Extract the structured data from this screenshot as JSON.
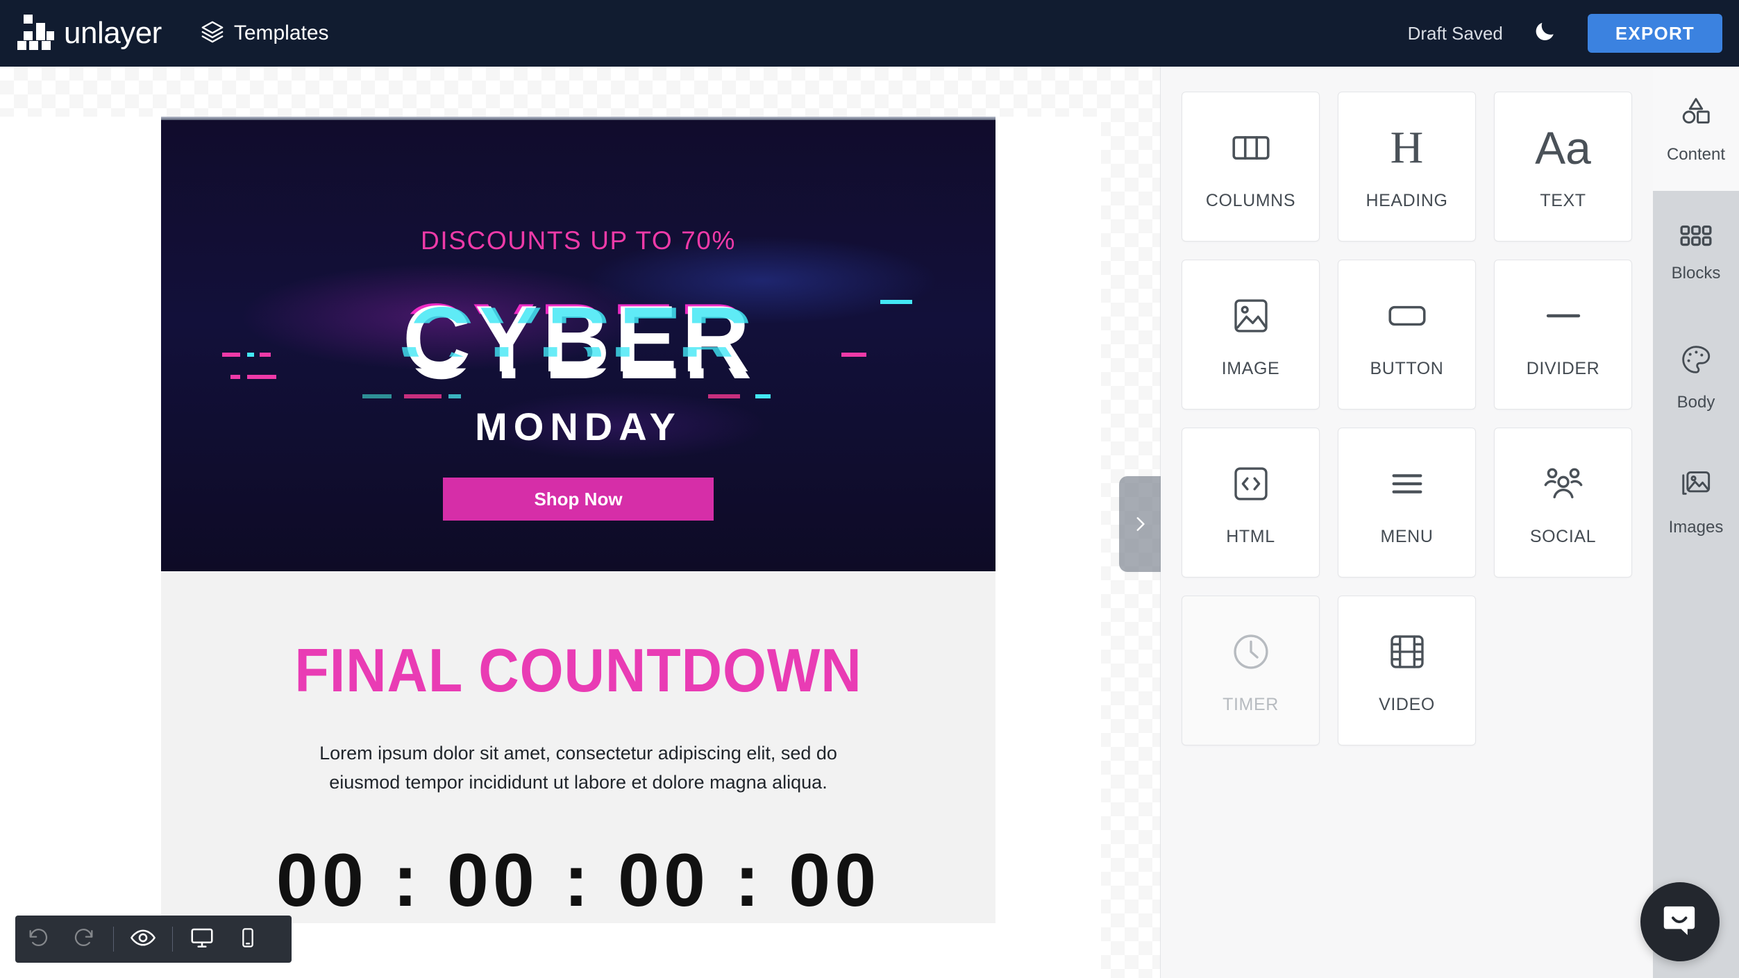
{
  "header": {
    "logo_text": "unlayer",
    "logo_icon": "unlayer-pixel-logo",
    "templates_label": "Templates",
    "templates_icon": "layers-icon",
    "draft_status": "Draft Saved",
    "dark_mode_icon": "moon-icon",
    "export_label": "EXPORT",
    "colors": {
      "header_bg": "#111c30",
      "export_bg": "#3b82e0"
    }
  },
  "email": {
    "hero": {
      "discount_text": "DISCOUNTS UP TO 70%",
      "title_glitch": "CYBER",
      "subtitle": "MONDAY",
      "cta_label": "Shop Now",
      "colors": {
        "bg": "#110c2c",
        "discount": "#ef3aa8",
        "cta_bg": "#d62ea8",
        "glitch_pink": "#ff2fd0",
        "glitch_cyan": "#43e8f5"
      }
    },
    "countdown": {
      "heading": "FINAL COUNTDOWN",
      "paragraph": "Lorem ipsum dolor sit amet, consectetur adipiscing elit, sed do eiusmod tempor incididunt ut labore et dolore magna aliqua.",
      "digits": "00 : 00 : 00 : 00",
      "heading_color": "#e93cb4",
      "bg": "#f2f2f2"
    }
  },
  "panel_handle": {
    "icon": "chevron-right-icon"
  },
  "editor_toolbar": {
    "buttons": [
      {
        "name": "undo",
        "icon": "undo-icon",
        "enabled": false
      },
      {
        "name": "redo",
        "icon": "redo-icon",
        "enabled": false
      },
      {
        "name": "preview",
        "icon": "eye-icon",
        "enabled": true
      },
      {
        "name": "desktop-view",
        "icon": "desktop-icon",
        "enabled": true
      },
      {
        "name": "mobile-view",
        "icon": "mobile-icon",
        "enabled": true
      }
    ]
  },
  "content_panel": {
    "tools": [
      {
        "label": "COLUMNS",
        "icon": "columns-icon",
        "disabled": false
      },
      {
        "label": "HEADING",
        "icon": "heading-icon",
        "disabled": false
      },
      {
        "label": "TEXT",
        "icon": "text-icon",
        "disabled": false
      },
      {
        "label": "IMAGE",
        "icon": "image-icon",
        "disabled": false
      },
      {
        "label": "BUTTON",
        "icon": "button-icon",
        "disabled": false
      },
      {
        "label": "DIVIDER",
        "icon": "divider-icon",
        "disabled": false
      },
      {
        "label": "HTML",
        "icon": "code-icon",
        "disabled": false
      },
      {
        "label": "MENU",
        "icon": "menu-icon",
        "disabled": false
      },
      {
        "label": "SOCIAL",
        "icon": "social-icon",
        "disabled": false
      },
      {
        "label": "TIMER",
        "icon": "clock-icon",
        "disabled": true
      },
      {
        "label": "VIDEO",
        "icon": "video-icon",
        "disabled": false
      }
    ]
  },
  "tab_rail": {
    "tabs": [
      {
        "label": "Content",
        "icon": "shapes-icon",
        "active": true
      },
      {
        "label": "Blocks",
        "icon": "grid-icon",
        "active": false
      },
      {
        "label": "Body",
        "icon": "palette-icon",
        "active": false
      },
      {
        "label": "Images",
        "icon": "images-icon",
        "active": false
      }
    ]
  },
  "chat": {
    "icon": "chat-bubble-smile-icon"
  }
}
